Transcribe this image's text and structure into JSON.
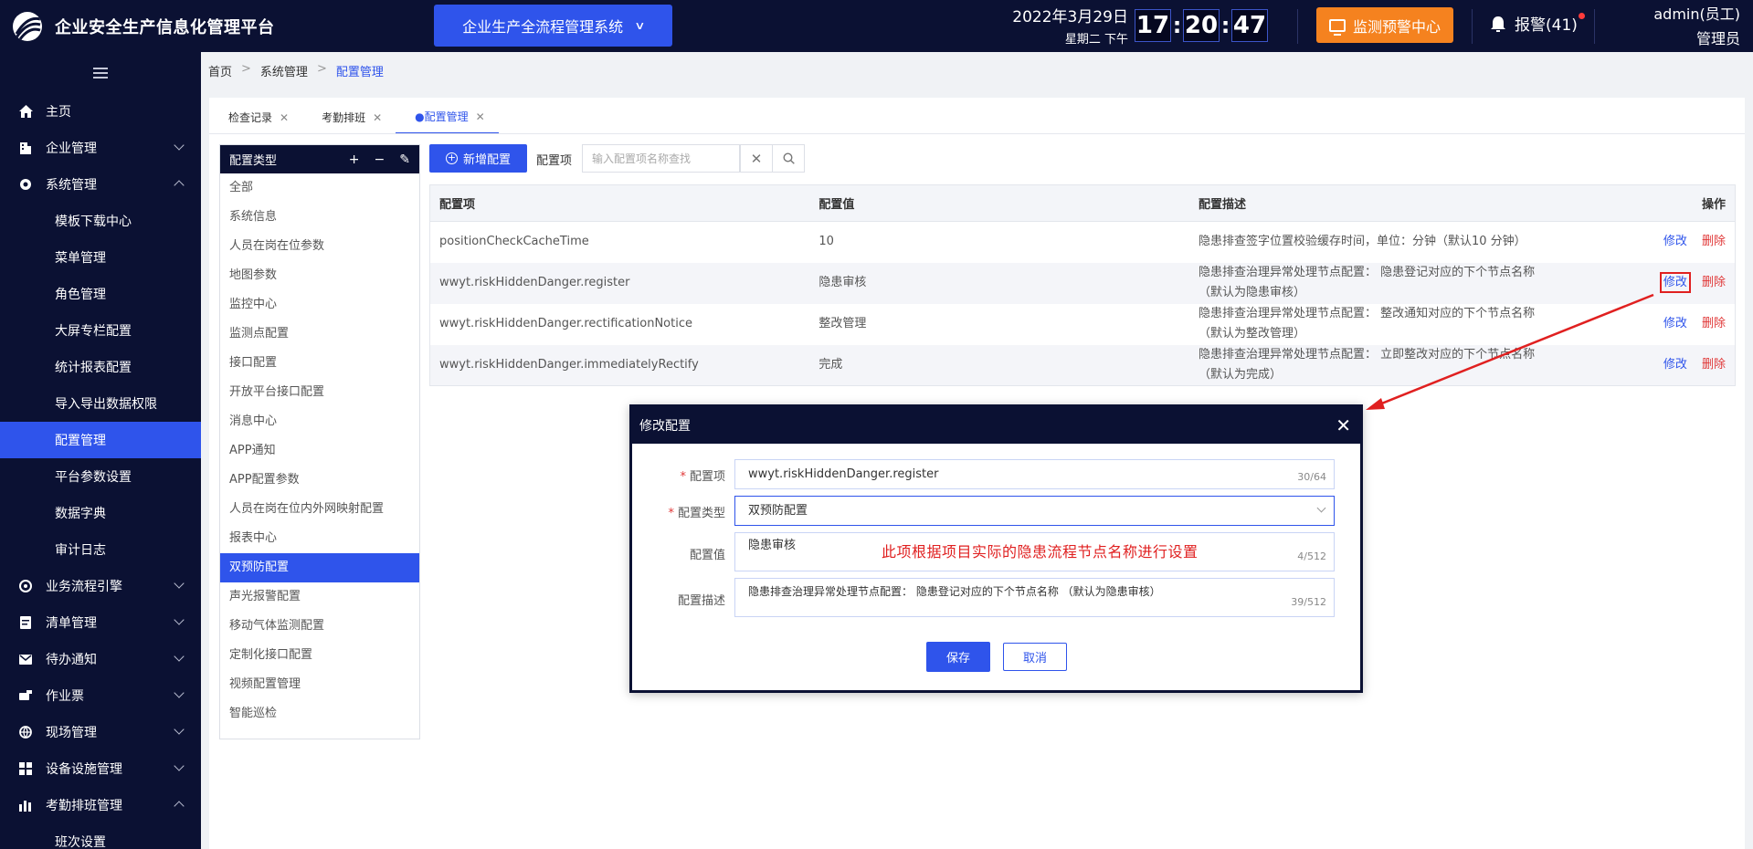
{
  "header": {
    "app_title": "企业安全生产信息化管理平台",
    "system_switch": "企业生产全流程管理系统",
    "date": "2022年3月29日",
    "weekday": "星期二 下午",
    "clock": {
      "h": "17",
      "m": "20",
      "s": "47"
    },
    "monitor_button": "监测预警中心",
    "alarm": "报警(41)",
    "user_name": "admin(员工)",
    "user_role": "管理员",
    "colors": {
      "bar": "#0b1133",
      "accent": "#2f54eb",
      "monitor": "#f5821f",
      "alarm_dot": "#ff3b3b"
    }
  },
  "sidebar": {
    "items": [
      {
        "label": "主页",
        "icon": "home-icon"
      },
      {
        "label": "企业管理",
        "icon": "building-icon"
      },
      {
        "label": "系统管理",
        "icon": "settings-icon"
      },
      {
        "label": "模板下载中心"
      },
      {
        "label": "菜单管理"
      },
      {
        "label": "角色管理"
      },
      {
        "label": "大屏专栏配置"
      },
      {
        "label": "统计报表配置"
      },
      {
        "label": "导入导出数据权限"
      },
      {
        "label": "配置管理"
      },
      {
        "label": "平台参数设置"
      },
      {
        "label": "数据字典"
      },
      {
        "label": "审计日志"
      },
      {
        "label": "业务流程引擎",
        "icon": "workflow-icon"
      },
      {
        "label": "清单管理",
        "icon": "list-icon"
      },
      {
        "label": "待办通知",
        "icon": "mail-icon"
      },
      {
        "label": "作业票",
        "icon": "ticket-icon"
      },
      {
        "label": "现场管理",
        "icon": "site-icon"
      },
      {
        "label": "设备设施管理",
        "icon": "device-icon"
      },
      {
        "label": "考勤排班管理",
        "icon": "chart-icon"
      },
      {
        "label": "班次设置"
      }
    ]
  },
  "breadcrumb": [
    "首页",
    "系统管理",
    "配置管理"
  ],
  "tabs": [
    {
      "label": "检查记录"
    },
    {
      "label": "考勤排班"
    },
    {
      "label": "●配置管理"
    }
  ],
  "type_panel": {
    "title": "配置类型",
    "items": [
      "全部",
      "系统信息",
      "人员在岗在位参数",
      "地图参数",
      "监控中心",
      "监测点配置",
      "接口配置",
      "开放平台接口配置",
      "消息中心",
      "APP通知",
      "APP配置参数",
      "人员在岗在位内外网映射配置",
      "报表中心",
      "双预防配置",
      "声光报警配置",
      "移动气体监测配置",
      "定制化接口配置",
      "视频配置管理",
      "智能巡检"
    ]
  },
  "toolbar": {
    "add_button": "新增配置",
    "search_label": "配置项",
    "search_placeholder": "输入配置项名称查找"
  },
  "table": {
    "headers": [
      "配置项",
      "配置值",
      "配置描述",
      "操作"
    ],
    "edit_label": "修改",
    "delete_label": "删除",
    "rows": [
      {
        "key": "positionCheckCacheTime",
        "value": "10",
        "desc1": "隐患排查签字位置校验缓存时间，单位：分钟（默认10 分钟）",
        "desc2": ""
      },
      {
        "key": "wwyt.riskHiddenDanger.register",
        "value": "隐患审核",
        "desc1": "隐患排查治理异常处理节点配置： 隐患登记对应的下个节点名称",
        "desc2": "（默认为隐患审核）"
      },
      {
        "key": "wwyt.riskHiddenDanger.rectificationNotice",
        "value": "整改管理",
        "desc1": "隐患排查治理异常处理节点配置： 整改通知对应的下个节点名称",
        "desc2": "（默认为整改管理）"
      },
      {
        "key": "wwyt.riskHiddenDanger.immediatelyRectify",
        "value": "完成",
        "desc1": "隐患排查治理异常处理节点配置： 立即整改对应的下个节点名称",
        "desc2": "（默认为完成）"
      }
    ]
  },
  "modal": {
    "title": "修改配置",
    "fields": {
      "key_label": "配置项",
      "key_value": "wwyt.riskHiddenDanger.register",
      "key_count": "30/64",
      "type_label": "配置类型",
      "type_value": "双预防配置",
      "value_label": "配置值",
      "value_value": "隐患审核",
      "value_count": "4/512",
      "value_note": "此项根据项目实际的隐患流程节点名称进行设置",
      "desc_label": "配置描述",
      "desc_value": "隐患排查治理异常处理节点配置： 隐患登记对应的下个节点名称 （默认为隐患审核）",
      "desc_count": "39/512"
    },
    "save": "保存",
    "cancel": "取消"
  }
}
